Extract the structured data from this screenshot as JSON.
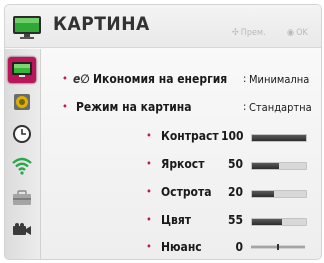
{
  "header": {
    "title": "КАРТИНА",
    "move_hint": "Прем.",
    "ok_hint": "OK"
  },
  "sidebar": {
    "items": [
      {
        "icon": "picture-icon",
        "active": true
      },
      {
        "icon": "speaker-icon",
        "active": false
      },
      {
        "icon": "clock-icon",
        "active": false
      },
      {
        "icon": "wifi-icon",
        "active": false
      },
      {
        "icon": "toolbox-icon",
        "active": false
      },
      {
        "icon": "video-camera-icon",
        "active": false
      }
    ]
  },
  "settings": {
    "energy": {
      "label": "Икономия на енергия",
      "value": "Минимална"
    },
    "mode": {
      "label": "Режим на картина",
      "value": "Стандартна"
    },
    "sliders": [
      {
        "label": "Контраст",
        "value": 100,
        "max": 100
      },
      {
        "label": "Яркост",
        "value": 50,
        "max": 100
      },
      {
        "label": "Острота",
        "value": 20,
        "max": 50
      },
      {
        "label": "Цвят",
        "value": 55,
        "max": 100
      }
    ],
    "tint": {
      "label": "Нюанс",
      "value": 0,
      "range": [
        -50,
        50
      ]
    }
  },
  "colors": {
    "accent": "#c2185b",
    "selected": "#b8175a",
    "bar_fill": "#333333"
  }
}
